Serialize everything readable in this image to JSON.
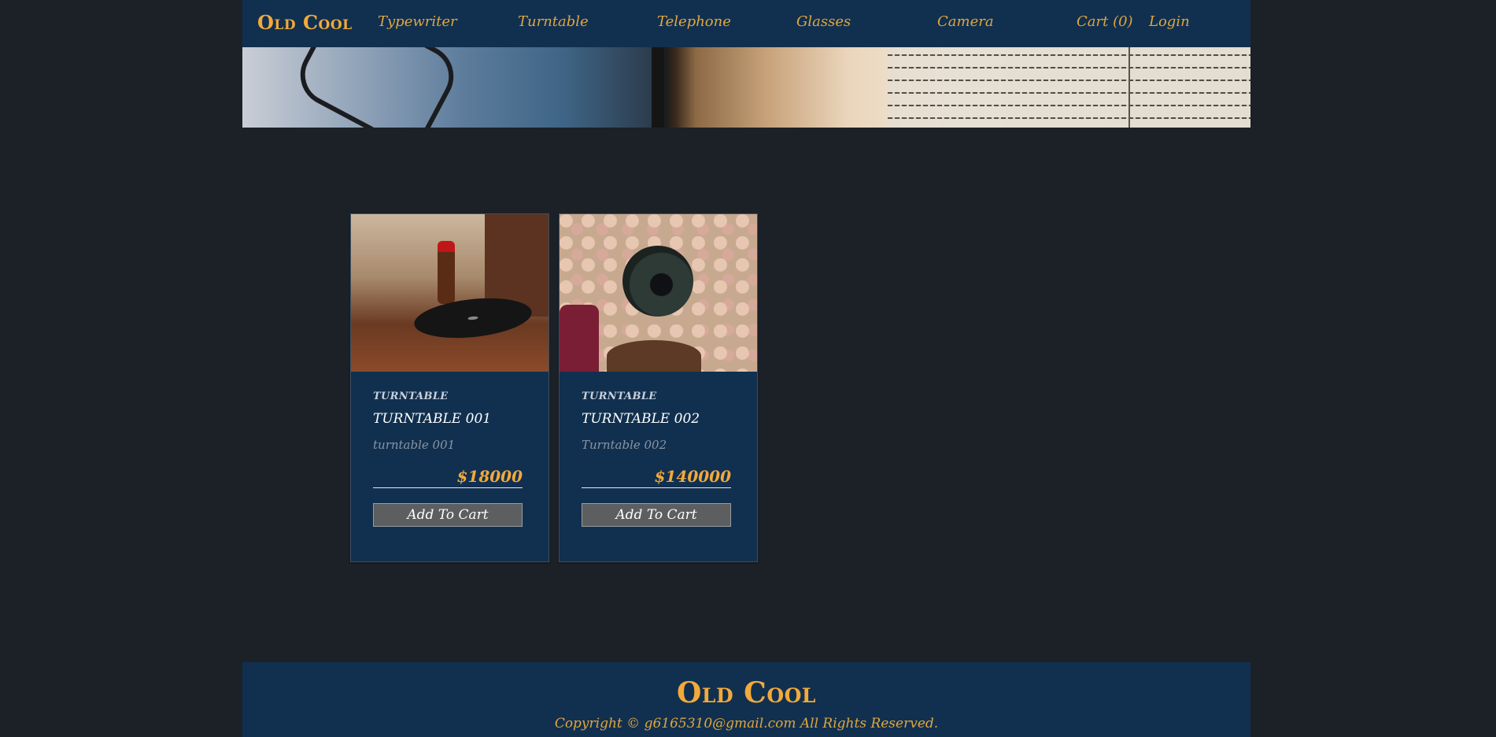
{
  "brand": "Old Cool",
  "nav": {
    "links": [
      "Typewriter",
      "Turntable",
      "Telephone",
      "Glasses",
      "Camera"
    ],
    "cart": "Cart (0)",
    "login": "Login"
  },
  "products": [
    {
      "category": "TURNTABLE",
      "name": "TURNTABLE 001",
      "description": "turntable 001",
      "price": "$18000",
      "button": "Add To Cart",
      "image": "turntable-with-telephone-photo"
    },
    {
      "category": "TURNTABLE",
      "name": "TURNTABLE 002",
      "description": "Turntable 002",
      "price": "$140000",
      "button": "Add To Cart",
      "image": "gramophone-photo"
    }
  ],
  "footer": {
    "brand": "Old Cool",
    "copyright": "Copyright © g6165310@gmail.com All Rights Reserved."
  },
  "colors": {
    "page_bg": "#1c2128",
    "navy": "#11304f",
    "accent": "#f2a93b",
    "button_bg": "#5c5e60"
  }
}
